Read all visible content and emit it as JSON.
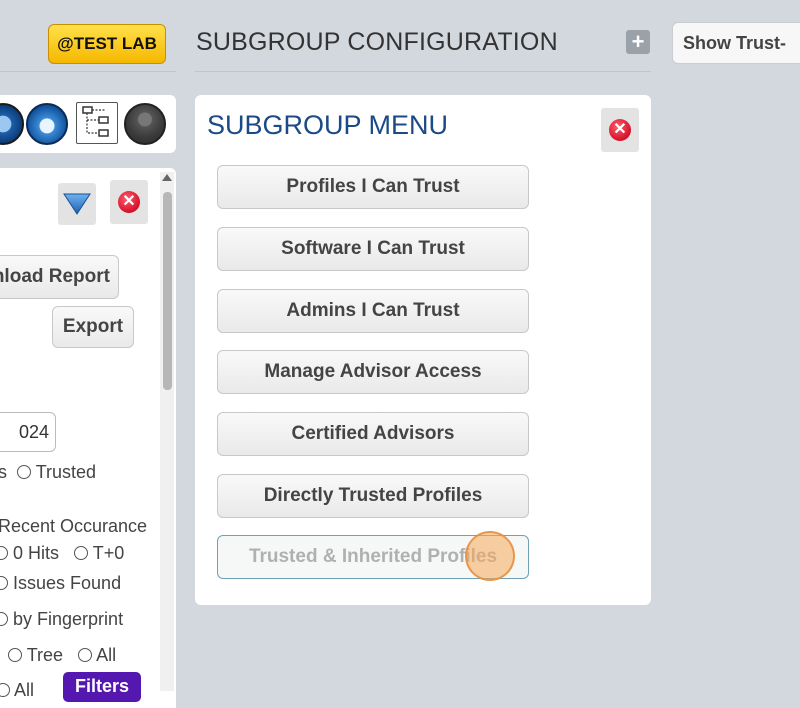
{
  "header": {
    "env_badge": "@TEST LAB",
    "page_title": "SUBGROUP CONFIGURATION",
    "add_icon": "plus-icon",
    "show_trust_label": "Show Trust-"
  },
  "left_panel": {
    "icons": [
      "globe-icon",
      "cloud-icon",
      "diagram-icon",
      "user-avatar-icon"
    ],
    "download_report_label": "nload Report",
    "export_label": "Export",
    "date_value": "024",
    "radio_row1": {
      "prefix": "s",
      "option": "Trusted"
    },
    "recent_occurance_label": "Recent Occurance",
    "radio_row2": [
      "0 Hits",
      "T+0"
    ],
    "issues_found": "Issues Found",
    "by_fingerprint": "by Fingerprint",
    "radio_row5": [
      "Tree",
      "All"
    ],
    "radio_row6": "All",
    "filters_label": "Filters"
  },
  "subgroup_menu": {
    "title": "SUBGROUP MENU",
    "items": [
      {
        "label": "Profiles I Can Trust"
      },
      {
        "label": "Software I Can Trust"
      },
      {
        "label": "Admins I Can Trust"
      },
      {
        "label": "Manage Advisor Access"
      },
      {
        "label": "Certified Advisors"
      },
      {
        "label": "Directly Trusted Profiles"
      },
      {
        "label": "Trusted & Inherited Profiles",
        "disabled": true
      }
    ]
  },
  "colors": {
    "background": "#d3d8de",
    "badge": "#ffd21a",
    "menu_title": "#1b4a86",
    "close": "#d3122a",
    "filters": "#5418b0"
  }
}
